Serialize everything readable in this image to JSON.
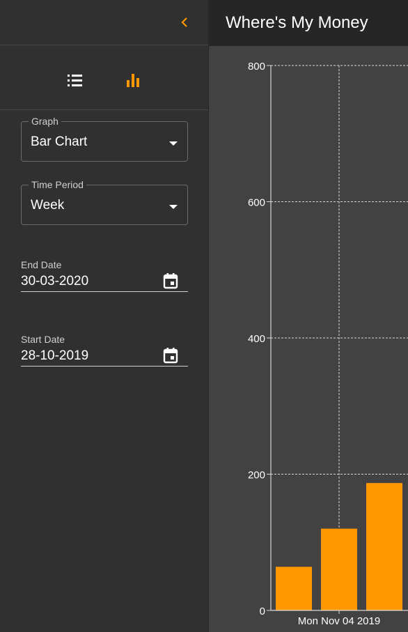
{
  "app": {
    "title": "Where's My Money"
  },
  "sidebar": {
    "collapse_icon": "chevron-left-icon",
    "view_toggle": [
      {
        "icon": "list-icon",
        "selected": false
      },
      {
        "icon": "bar-chart-icon",
        "selected": true
      }
    ],
    "graph": {
      "label": "Graph",
      "value": "Bar Chart"
    },
    "time_period": {
      "label": "Time Period",
      "value": "Week"
    },
    "end_date": {
      "label": "End Date",
      "value": "30-03-2020",
      "icon": "calendar-icon"
    },
    "start_date": {
      "label": "Start Date",
      "value": "28-10-2019",
      "icon": "calendar-icon"
    }
  },
  "colors": {
    "accent": "#ff9800",
    "sidebar_bg": "#303030",
    "appbar_bg": "#262626",
    "chart_bg": "#424242"
  },
  "chart_data": {
    "type": "bar",
    "categories": [
      "",
      "Mon Nov 04 2019",
      ""
    ],
    "values": [
      64,
      120,
      187
    ],
    "ylim": [
      0,
      800
    ],
    "yticks": [
      0,
      200,
      400,
      600,
      800
    ],
    "grid": true,
    "bar_color": "#ff9800"
  }
}
